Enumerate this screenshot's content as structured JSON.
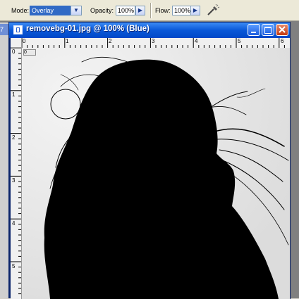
{
  "options_bar": {
    "mode_label": "Mode:",
    "mode_value": "Overlay",
    "opacity_label": "Opacity:",
    "opacity_value": "100%",
    "flow_label": "Flow:",
    "flow_value": "100%",
    "airbrush_icon": "airbrush-icon"
  },
  "background_doc": {
    "partial_zoom": "7"
  },
  "document": {
    "title": "removebg-01.jpg @ 100% (Blue)",
    "window_buttons": [
      "minimize",
      "maximize",
      "close"
    ],
    "hruler_labels": [
      "0",
      "1",
      "2",
      "3",
      "4",
      "5",
      "6"
    ],
    "vruler_labels": [
      "0",
      "1",
      "2",
      "3",
      "4",
      "5"
    ],
    "tile_indicator": "0"
  },
  "brush_cursor": "brush-cursor-circle",
  "colors": {
    "title_bar": "#0a58d8",
    "close_button": "#c43a14",
    "selected_field": "#316ac5",
    "silhouette": "#000000",
    "canvas": "#ffffff"
  }
}
